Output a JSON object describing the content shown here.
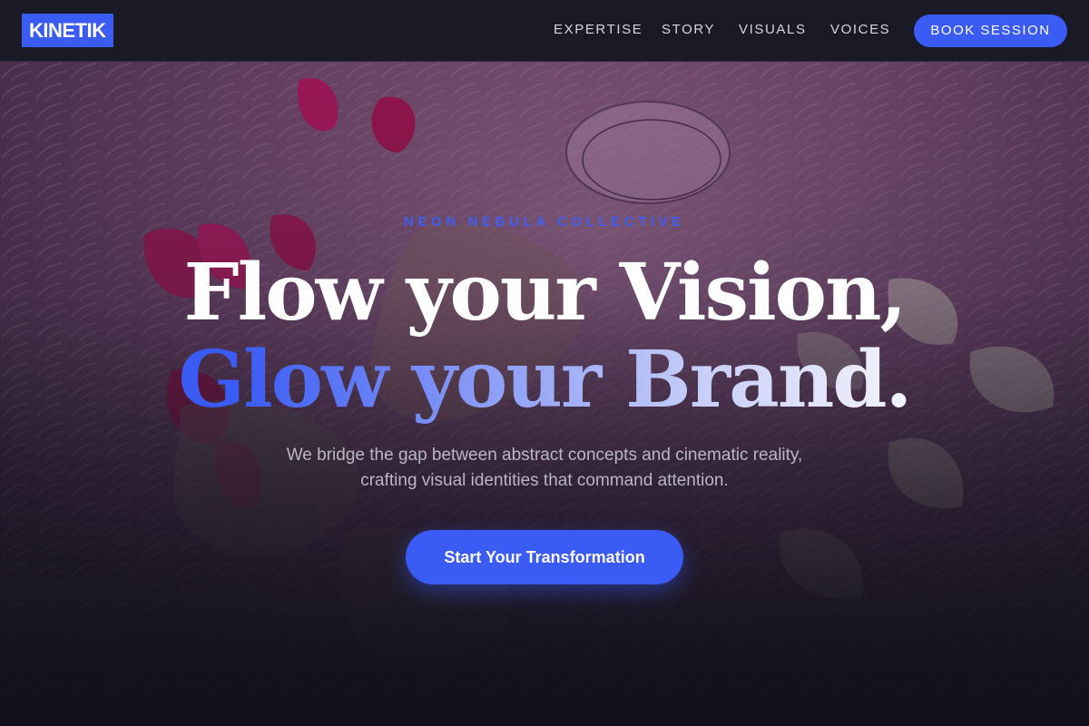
{
  "brand": {
    "logo_text": "KINETIK",
    "accent": "#3a5cf5"
  },
  "nav": {
    "links": [
      {
        "label": "EXPERTISE"
      },
      {
        "label": "STORY"
      },
      {
        "label": "VISUALS"
      },
      {
        "label": "VOICES"
      }
    ],
    "cta_label": "BOOK SESSION"
  },
  "hero": {
    "eyebrow": "NEON NEBULA COLLECTIVE",
    "headline_line1": "Flow your Vision,",
    "headline_line2": "Glow your Brand.",
    "subcopy_line1": "We bridge the gap between abstract concepts and cinematic reality,",
    "subcopy_line2": "crafting visual identities that command attention.",
    "cta_label": "Start Your Transformation",
    "background_image": "photo of a hand with rings on pink fur rug with petals and a glass"
  },
  "colors": {
    "nav_bg": "#1a1926",
    "page_bg": "#12111b",
    "eyebrow": "#3f5ef2",
    "headline_gradient_start": "#3a5cf5",
    "headline_gradient_end": "#f1f1fb"
  }
}
